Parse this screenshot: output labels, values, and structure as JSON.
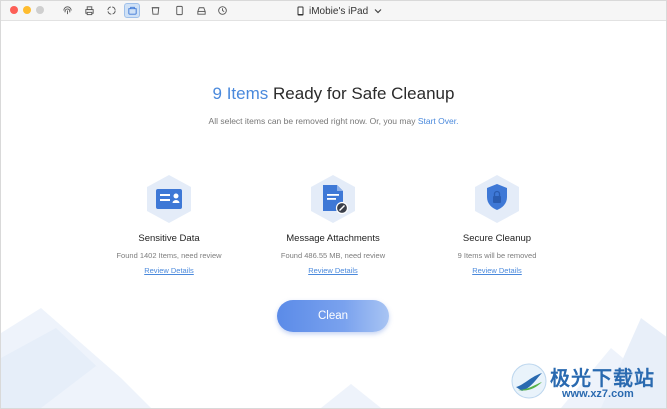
{
  "titlebar": {
    "device_name": "iMobie's iPad",
    "toolbar_icons": [
      "fingerprint-icon",
      "printer-icon",
      "sync-icon",
      "cleanup-icon",
      "trash-icon",
      "phone-icon",
      "drive-icon",
      "clock-icon"
    ],
    "active_tool": "cleanup-icon"
  },
  "main": {
    "headline_count": "9 Items",
    "headline_rest": " Ready for Safe Cleanup",
    "subline_text": "All select items can be removed right now. Or, you may ",
    "subline_link": "Start Over."
  },
  "cards": [
    {
      "title": "Sensitive Data",
      "desc": "Found 1402 Items, need review",
      "link": "Review Details",
      "icon": "id-card-icon"
    },
    {
      "title": "Message Attachments",
      "desc": "Found 486.55 MB, need review",
      "link": "Review Details",
      "icon": "attachment-doc-icon"
    },
    {
      "title": "Secure Cleanup",
      "desc": "9 Items will be removed",
      "link": "Review Details",
      "icon": "shield-lock-icon"
    }
  ],
  "clean_button": {
    "label": "Clean"
  },
  "watermark": {
    "text": "极光下载站",
    "url": "www.xz7.com"
  },
  "colors": {
    "accent": "#4a89dc",
    "hex_bg": "#e4ecf8",
    "icon_blue": "#3e78d6"
  }
}
